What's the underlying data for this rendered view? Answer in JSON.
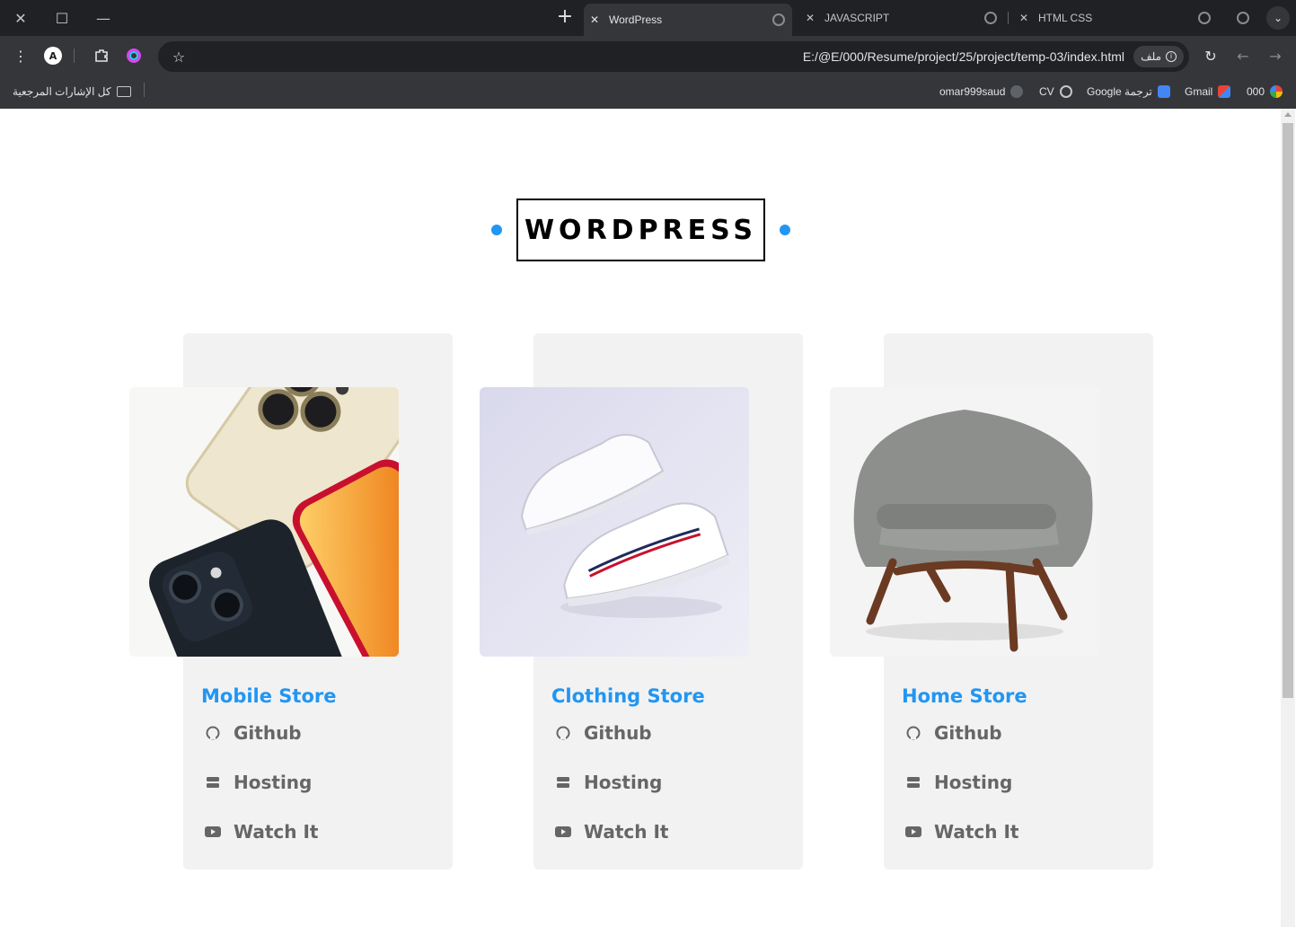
{
  "browser": {
    "tabs": [
      {
        "label": "WordPress",
        "active": true
      },
      {
        "label": "JAVASCRIPT",
        "active": false
      },
      {
        "label": "HTML CSS",
        "active": false
      }
    ],
    "url": "E:/@E/000/Resume/project/25/project/temp-03/index.html",
    "url_chip": "ملف",
    "bookmarks": [
      {
        "label": "000",
        "icon": "google-icon"
      },
      {
        "label": "Gmail",
        "icon": "gmail-icon"
      },
      {
        "label": "Google ترجمة",
        "icon": "translate-icon"
      },
      {
        "label": "CV",
        "icon": "globe-icon"
      },
      {
        "label": "omar999saud",
        "icon": "github-icon"
      }
    ],
    "all_bookmarks": "كل الإشارات المرجعية"
  },
  "page": {
    "heading": "WORDPRESS",
    "accent": "#2196f3",
    "cards": [
      {
        "title": "Mobile Store",
        "image": "phones-photo",
        "links": [
          "Github",
          "Hosting",
          "Watch It"
        ]
      },
      {
        "title": "Clothing Store",
        "image": "sneakers-photo",
        "links": [
          "Github",
          "Hosting",
          "Watch It"
        ]
      },
      {
        "title": "Home Store",
        "image": "armchair-photo",
        "links": [
          "Github",
          "Hosting",
          "Watch It"
        ]
      }
    ]
  }
}
